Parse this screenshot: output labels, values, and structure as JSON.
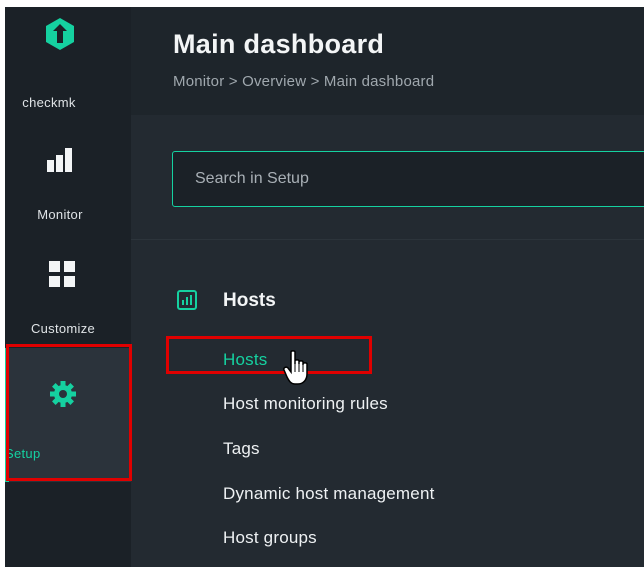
{
  "sidebar": {
    "logo_label": "checkmk",
    "monitor_label": "Monitor",
    "customize_label": "Customize",
    "setup_label": "Setup"
  },
  "header": {
    "title": "Main dashboard",
    "breadcrumb": "Monitor > Overview > Main dashboard"
  },
  "search": {
    "placeholder": "Search in Setup"
  },
  "section": {
    "title": "Hosts",
    "items": [
      {
        "label": "Hosts"
      },
      {
        "label": "Host monitoring rules"
      },
      {
        "label": "Tags"
      },
      {
        "label": "Dynamic host management"
      },
      {
        "label": "Host groups"
      }
    ]
  },
  "colors": {
    "accent": "#15d1a0",
    "highlight": "#e00000",
    "background": "#232a31"
  },
  "icons": [
    "checkmk-logo-icon",
    "monitor-icon",
    "customize-icon",
    "gear-icon",
    "hosts-section-icon",
    "hand-cursor-icon"
  ]
}
